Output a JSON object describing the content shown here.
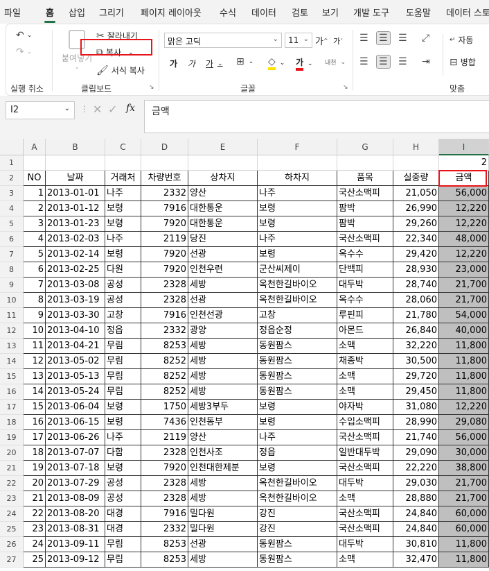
{
  "tabs": [
    "파일",
    "홈",
    "삽입",
    "그리기",
    "페이지 레이아웃",
    "수식",
    "데이터",
    "검토",
    "보기",
    "개발 도구",
    "도움말",
    "데이터 스토"
  ],
  "active_tab": "홈",
  "ribbon": {
    "undo_label": "실행 취소",
    "paste_label": "붙여넣기",
    "cut_label": "잘라내기",
    "copy_label": "복사",
    "format_painter_label": "서식 복사",
    "clipboard_label": "클립보드",
    "font_name": "맑은 고딕",
    "font_size": "11",
    "grow_font": "가",
    "shrink_font": "가",
    "bold": "가",
    "italic": "가",
    "underline": "가",
    "font_color_glyph": "가",
    "phonetic": "내천",
    "font_group_label": "글꼴",
    "wrap_label": "자동",
    "merge_label": "병합",
    "align_group_label": "맞춤",
    "font_color_accent": "#e8141a",
    "fill_color_accent": "#ffe000"
  },
  "formula_bar": {
    "name_box": "I2",
    "content": "금액"
  },
  "sheet": {
    "columns": [
      "A",
      "B",
      "C",
      "D",
      "E",
      "F",
      "G",
      "H",
      "I"
    ],
    "selected_column": "I",
    "row_numbers": [
      "1",
      "2",
      "3",
      "4",
      "5",
      "6",
      "7",
      "8",
      "9",
      "10",
      "11",
      "12",
      "13",
      "14",
      "15",
      "16",
      "17",
      "18",
      "19",
      "20",
      "21",
      "22",
      "23",
      "24",
      "25",
      "26",
      "27"
    ],
    "r1_value": "2",
    "headers": [
      "NO",
      "날짜",
      "거래처",
      "차량번호",
      "상차지",
      "하차지",
      "품목",
      "실중량",
      "금액"
    ],
    "rows": [
      [
        "1",
        "2013-01-01",
        "나주",
        "2332",
        "양산",
        "나주",
        "국산소맥피",
        "21,050",
        "56,000"
      ],
      [
        "2",
        "2013-01-12",
        "보령",
        "7916",
        "대한통운",
        "보령",
        "팜박",
        "26,990",
        "12,220"
      ],
      [
        "3",
        "2013-01-23",
        "보령",
        "7920",
        "대한통운",
        "보령",
        "팜박",
        "29,260",
        "12,220"
      ],
      [
        "4",
        "2013-02-03",
        "나주",
        "2119",
        "당진",
        "나주",
        "국산소맥피",
        "22,340",
        "48,000"
      ],
      [
        "5",
        "2013-02-14",
        "보령",
        "7920",
        "선광",
        "보령",
        "옥수수",
        "29,420",
        "12,220"
      ],
      [
        "6",
        "2013-02-25",
        "다원",
        "7920",
        "인천우련",
        "군산씨제이",
        "단백피",
        "28,930",
        "23,000"
      ],
      [
        "7",
        "2013-03-08",
        "공성",
        "2328",
        "세방",
        "옥천한길바이오",
        "대두박",
        "28,740",
        "21,700"
      ],
      [
        "8",
        "2013-03-19",
        "공성",
        "2328",
        "선광",
        "옥천한길바이오",
        "옥수수",
        "28,060",
        "21,700"
      ],
      [
        "9",
        "2013-03-30",
        "고창",
        "7916",
        "인천선광",
        "고창",
        "루핀피",
        "21,780",
        "54,000"
      ],
      [
        "10",
        "2013-04-10",
        "정읍",
        "2332",
        "광양",
        "정읍순정",
        "아몬드",
        "26,840",
        "40,000"
      ],
      [
        "11",
        "2013-04-21",
        "무림",
        "8253",
        "세방",
        "동원팜스",
        "소맥",
        "32,220",
        "11,800"
      ],
      [
        "12",
        "2013-05-02",
        "무림",
        "8252",
        "세방",
        "동원팜스",
        "채종박",
        "30,500",
        "11,800"
      ],
      [
        "13",
        "2013-05-13",
        "무림",
        "8252",
        "세방",
        "동원팜스",
        "소맥",
        "29,720",
        "11,800"
      ],
      [
        "14",
        "2013-05-24",
        "무림",
        "8252",
        "세방",
        "동원팜스",
        "소맥",
        "29,450",
        "11,800"
      ],
      [
        "15",
        "2013-06-04",
        "보령",
        "1750",
        "세방3부두",
        "보령",
        "야자박",
        "31,080",
        "12,220"
      ],
      [
        "16",
        "2013-06-15",
        "보령",
        "7436",
        "인천동부",
        "보령",
        "수입소맥피",
        "28,990",
        "29,080"
      ],
      [
        "17",
        "2013-06-26",
        "나주",
        "2119",
        "양산",
        "나주",
        "국산소맥피",
        "21,740",
        "56,000"
      ],
      [
        "18",
        "2013-07-07",
        "다함",
        "2328",
        "인천사조",
        "정읍",
        "일반대두박",
        "29,090",
        "30,000"
      ],
      [
        "19",
        "2013-07-18",
        "보령",
        "7920",
        "인천대한제분",
        "보령",
        "국산소맥피",
        "22,220",
        "38,800"
      ],
      [
        "20",
        "2013-07-29",
        "공성",
        "2328",
        "세방",
        "옥천한길바이오",
        "대두박",
        "29,030",
        "21,700"
      ],
      [
        "21",
        "2013-08-09",
        "공성",
        "2328",
        "세방",
        "옥천한길바이오",
        "소맥",
        "28,880",
        "21,700"
      ],
      [
        "22",
        "2013-08-20",
        "대경",
        "7916",
        "밀다원",
        "강진",
        "국산소맥피",
        "24,840",
        "60,000"
      ],
      [
        "23",
        "2013-08-31",
        "대경",
        "2332",
        "밀다원",
        "강진",
        "국산소맥피",
        "24,840",
        "60,000"
      ],
      [
        "24",
        "2013-09-11",
        "무림",
        "8253",
        "선광",
        "동원팜스",
        "대두박",
        "30,810",
        "11,800"
      ],
      [
        "25",
        "2013-09-12",
        "무림",
        "8253",
        "세방",
        "동원팜스",
        "소맥",
        "32,470",
        "11,800"
      ]
    ]
  }
}
